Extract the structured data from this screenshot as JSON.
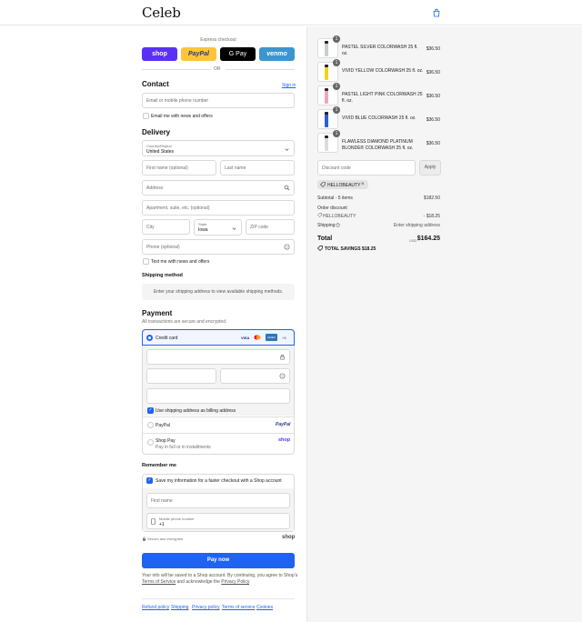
{
  "header": {
    "logo": "Celeb",
    "cart_icon": "shopping-bag-icon"
  },
  "express": {
    "label": "Express checkout",
    "shop": "shop",
    "paypal": "PayPal",
    "gpay": "G Pay",
    "venmo": "venmo",
    "or": "OR"
  },
  "contact": {
    "title": "Contact",
    "sign_in": "Sign in",
    "email_placeholder": "Email or mobile phone number",
    "news_label": "Email me with news and offers"
  },
  "delivery": {
    "title": "Delivery",
    "country_label": "Country/Region",
    "country_value": "United States",
    "first_name": "First name (optional)",
    "last_name": "Last name",
    "address": "Address",
    "apartment": "Apartment, suite, etc. (optional)",
    "city": "City",
    "state_label": "State",
    "state_value": "Iowa",
    "zip": "ZIP code",
    "phone": "Phone (optional)",
    "text_news": "Text me with news and offers"
  },
  "shipping": {
    "title": "Shipping method",
    "message": "Enter your shipping address to view available shipping methods."
  },
  "payment": {
    "title": "Payment",
    "subtitle": "All transactions are secure and encrypted.",
    "credit_card": "Credit card",
    "card_brands": [
      "VISA",
      "MC",
      "AMEX",
      "+3"
    ],
    "billing_label": "Use shipping address as billing address",
    "paypal": "PayPal",
    "paypal_logo": "PayPal",
    "shop_pay": "Shop Pay",
    "shop_pay_sub": "Pay in full or in installments",
    "shop_logo": "shop"
  },
  "remember": {
    "title": "Remember me",
    "save_label": "Save my information for a faster checkout with a Shop account",
    "first_name": "First name",
    "mobile_label": "Mobile phone number",
    "mobile_value": "+1",
    "secure": "Secure and encrypted",
    "shop_logo": "shop"
  },
  "pay_now": "Pay now",
  "legal": {
    "text1": "Your info will be saved to a Shop account. By continuing, you agree to Shop’s",
    "tos": "Terms of Service",
    "text2": "and acknowledge the",
    "privacy": "Privacy Policy",
    "end": "."
  },
  "footer": [
    "Refund policy",
    "Shipping",
    "Privacy policy",
    "Terms of service",
    "Cookies"
  ],
  "products": [
    {
      "name": "PASTEL SILVER COLORWASH 25 fl. oz.",
      "price": "$36.50",
      "qty": "1",
      "color": "#c9ccd1"
    },
    {
      "name": "VIVID YELLOW COLORWASH 25 fl. oz.",
      "price": "$36.50",
      "qty": "1",
      "color": "#f2d21b"
    },
    {
      "name": "PASTEL LIGHT PINK COLORWASH 25 fl. oz.",
      "price": "$36.50",
      "qty": "1",
      "color": "#f1a7b8"
    },
    {
      "name": "VIVID BLUE COLORWASH 25 fl. oz.",
      "price": "$36.50",
      "qty": "1",
      "color": "#2a5fd6"
    },
    {
      "name": "FLAWLESS DIAMOND PLATINUM BLONDE® COLORWASH 25 fl. oz.",
      "price": "$36.50",
      "qty": "1",
      "color": "#dcdcdc"
    }
  ],
  "discount": {
    "placeholder": "Discount code",
    "apply": "Apply",
    "code_tag": "HELLOBEAUTY"
  },
  "summary": {
    "subtotal_label": "Subtotal · 5 items",
    "subtotal_value": "$182.50",
    "order_discount": "Order discount",
    "discount_code": "HELLOBEAUTY",
    "discount_value": "- $18.25",
    "shipping_label": "Shipping",
    "shipping_value": "Enter shipping address",
    "total_label": "Total",
    "currency": "USD",
    "total_value": "$164.25",
    "savings_label": "TOTAL SAVINGS",
    "savings_value": "$18.25"
  },
  "colors": {
    "accent": "#1f63f0",
    "shop_purple": "#5a31f4",
    "paypal_yellow": "#ffc439",
    "venmo_blue": "#3d95ce"
  }
}
